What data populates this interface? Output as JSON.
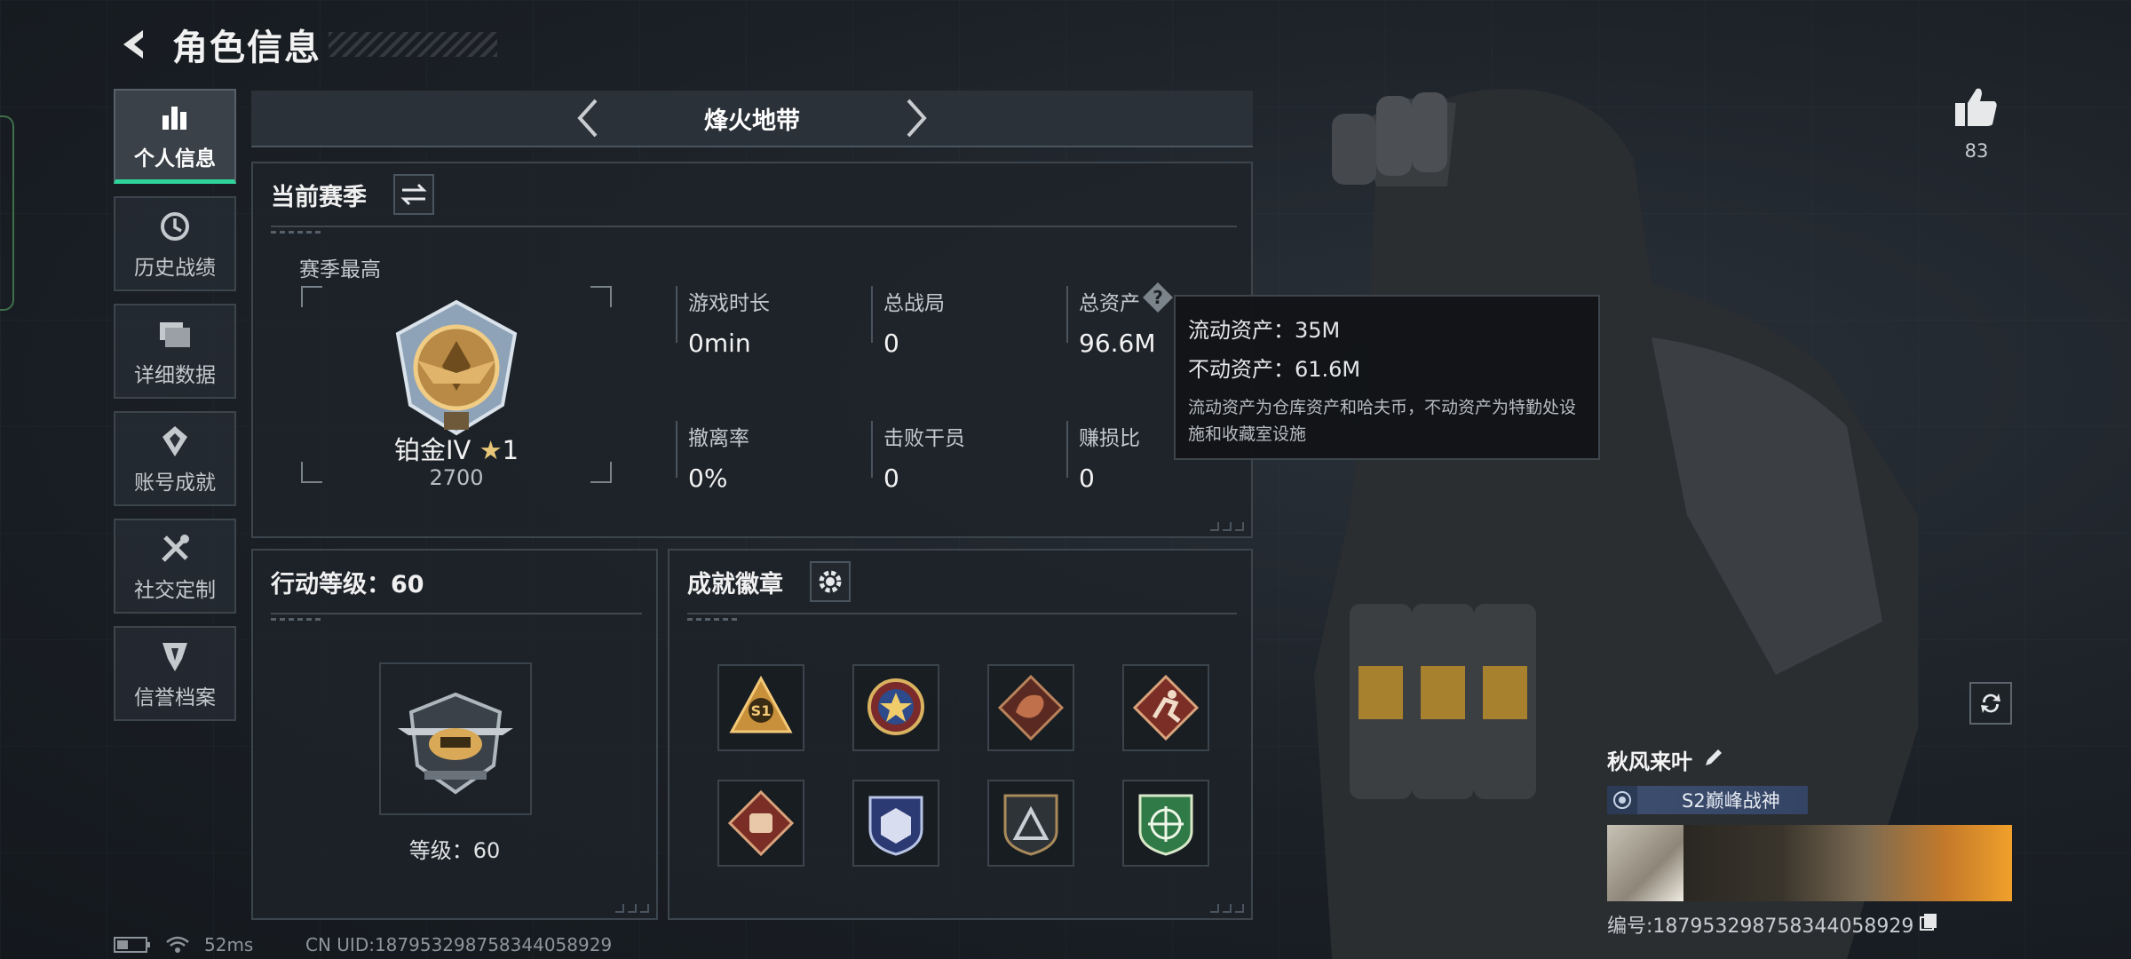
{
  "header": {
    "title": "角色信息"
  },
  "nav": {
    "items": [
      {
        "label": "个人信息",
        "icon": "bar-chart-icon",
        "active": true
      },
      {
        "label": "历史战绩",
        "icon": "history-icon",
        "active": false
      },
      {
        "label": "详细数据",
        "icon": "folder-icon",
        "active": false
      },
      {
        "label": "账号成就",
        "icon": "achievement-icon",
        "active": false
      },
      {
        "label": "社交定制",
        "icon": "tools-icon",
        "active": false
      },
      {
        "label": "信誉档案",
        "icon": "shield-icon",
        "active": false
      }
    ]
  },
  "mode": {
    "title": "烽火地带"
  },
  "season": {
    "title": "当前赛季",
    "best_label": "赛季最高",
    "rank_name": "铂金IV",
    "rank_stars": "1",
    "rank_score": "2700",
    "stats": [
      {
        "label": "游戏时长",
        "value": "0min"
      },
      {
        "label": "总战局",
        "value": "0"
      },
      {
        "label": "总资产",
        "value": "96.6M"
      },
      {
        "label": "撤离率",
        "value": "0%"
      },
      {
        "label": "击败干员",
        "value": "0"
      },
      {
        "label": "赚损比",
        "value": "0"
      }
    ]
  },
  "tooltip": {
    "liquid": "流动资产：35M",
    "fixed": "不动资产：61.6M",
    "note": "流动资产为仓库资产和哈夫币，不动资产为特勤处设施和收藏室设施"
  },
  "level": {
    "title": "行动等级：60",
    "level_text": "等级：60"
  },
  "badges": {
    "title": "成就徽章",
    "badge_text_s1": "S1"
  },
  "profile": {
    "likes": "83",
    "player_name": "秋风来叶",
    "title": "S2巅峰战神",
    "uid": "编号:1879532987583440589​29"
  },
  "status": {
    "ping": "52ms",
    "cn_uid": "CN UID:1879532987583440589​29"
  },
  "colors": {
    "accent": "#2fd49a",
    "bg": "#1b2026"
  }
}
